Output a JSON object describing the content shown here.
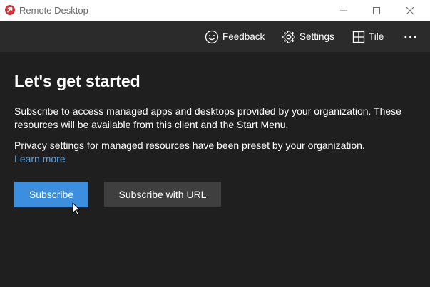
{
  "window": {
    "title": "Remote Desktop",
    "accent_color": "#d13438"
  },
  "commandbar": {
    "feedback_label": "Feedback",
    "settings_label": "Settings",
    "tile_label": "Tile",
    "more_icon": "ellipsis-icon"
  },
  "main": {
    "heading": "Let's get started",
    "paragraph_1": "Subscribe to access managed apps and desktops provided by your organization. These resources will be available from this client and the Start Menu.",
    "paragraph_2": "Privacy settings for managed resources have been preset by your organization.",
    "learn_more": "Learn more",
    "subscribe_label": "Subscribe",
    "subscribe_url_label": "Subscribe with URL",
    "primary_color": "#3c8fdf",
    "secondary_color": "#3f3f3f",
    "link_color": "#4aa3f0"
  }
}
